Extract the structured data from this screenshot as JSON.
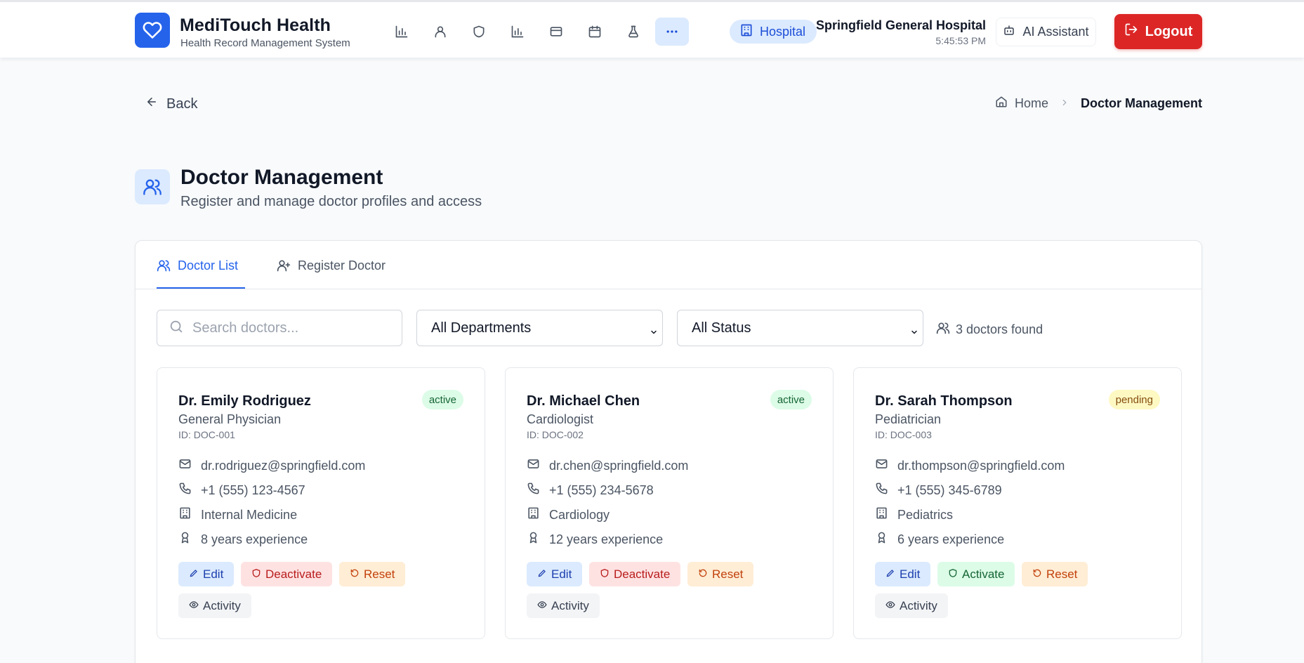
{
  "app": {
    "title": "MediTouch Health",
    "subtitle": "Health Record Management System"
  },
  "nav_icons": [
    "bar-chart-icon",
    "user-icon",
    "shield-icon",
    "bar-chart-icon",
    "card-icon",
    "calendar-icon",
    "flask-icon",
    "more-icon"
  ],
  "header": {
    "role_badge": "Hospital",
    "hospital_name": "Springfield General Hospital",
    "time": "5:45:53 PM",
    "ai_assistant": "AI Assistant",
    "logout": "Logout"
  },
  "subnav": {
    "back": "Back",
    "breadcrumb_home": "Home",
    "breadcrumb_current": "Doctor Management"
  },
  "page": {
    "title": "Doctor Management",
    "subtitle": "Register and manage doctor profiles and access"
  },
  "tabs": [
    {
      "label": "Doctor List",
      "active": true
    },
    {
      "label": "Register Doctor",
      "active": false
    }
  ],
  "filters": {
    "search_placeholder": "Search doctors...",
    "department": "All Departments",
    "status": "All Status",
    "found": "3 doctors found"
  },
  "doctors": [
    {
      "name": "Dr. Emily Rodriguez",
      "role": "General Physician",
      "id": "ID: DOC-001",
      "status": "active",
      "email": "dr.rodriguez@springfield.com",
      "phone": "+1 (555) 123-4567",
      "department": "Internal Medicine",
      "experience": "8 years experience",
      "actions": {
        "edit": "Edit",
        "toggle": "Deactivate",
        "reset": "Reset",
        "activity": "Activity"
      }
    },
    {
      "name": "Dr. Michael Chen",
      "role": "Cardiologist",
      "id": "ID: DOC-002",
      "status": "active",
      "email": "dr.chen@springfield.com",
      "phone": "+1 (555) 234-5678",
      "department": "Cardiology",
      "experience": "12 years experience",
      "actions": {
        "edit": "Edit",
        "toggle": "Deactivate",
        "reset": "Reset",
        "activity": "Activity"
      }
    },
    {
      "name": "Dr. Sarah Thompson",
      "role": "Pediatrician",
      "id": "ID: DOC-003",
      "status": "pending",
      "email": "dr.thompson@springfield.com",
      "phone": "+1 (555) 345-6789",
      "department": "Pediatrics",
      "experience": "6 years experience",
      "actions": {
        "edit": "Edit",
        "toggle": "Activate",
        "reset": "Reset",
        "activity": "Activity"
      }
    }
  ],
  "colors": {
    "primary": "#2563eb",
    "danger": "#dc2626",
    "success_bg": "#dcfce7",
    "warning_bg": "#fef9c3"
  }
}
